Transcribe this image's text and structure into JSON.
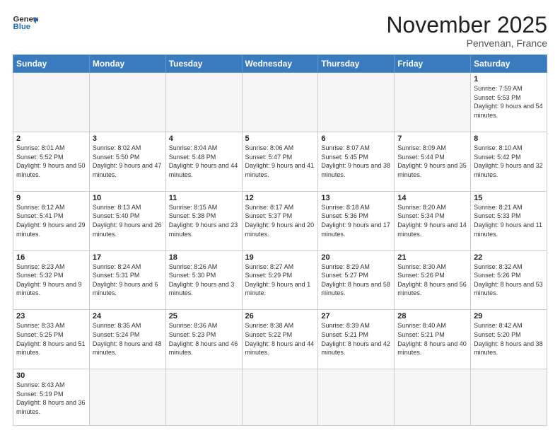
{
  "header": {
    "logo_general": "General",
    "logo_blue": "Blue",
    "month_title": "November 2025",
    "location": "Penvenan, France"
  },
  "days_of_week": [
    "Sunday",
    "Monday",
    "Tuesday",
    "Wednesday",
    "Thursday",
    "Friday",
    "Saturday"
  ],
  "weeks": [
    [
      {
        "day": "",
        "empty": true
      },
      {
        "day": "",
        "empty": true
      },
      {
        "day": "",
        "empty": true
      },
      {
        "day": "",
        "empty": true
      },
      {
        "day": "",
        "empty": true
      },
      {
        "day": "",
        "empty": true
      },
      {
        "day": "1",
        "sunrise": "7:59 AM",
        "sunset": "5:53 PM",
        "daylight": "9 hours and 54 minutes."
      }
    ],
    [
      {
        "day": "2",
        "sunrise": "8:01 AM",
        "sunset": "5:52 PM",
        "daylight": "9 hours and 50 minutes."
      },
      {
        "day": "3",
        "sunrise": "8:02 AM",
        "sunset": "5:50 PM",
        "daylight": "9 hours and 47 minutes."
      },
      {
        "day": "4",
        "sunrise": "8:04 AM",
        "sunset": "5:48 PM",
        "daylight": "9 hours and 44 minutes."
      },
      {
        "day": "5",
        "sunrise": "8:06 AM",
        "sunset": "5:47 PM",
        "daylight": "9 hours and 41 minutes."
      },
      {
        "day": "6",
        "sunrise": "8:07 AM",
        "sunset": "5:45 PM",
        "daylight": "9 hours and 38 minutes."
      },
      {
        "day": "7",
        "sunrise": "8:09 AM",
        "sunset": "5:44 PM",
        "daylight": "9 hours and 35 minutes."
      },
      {
        "day": "8",
        "sunrise": "8:10 AM",
        "sunset": "5:42 PM",
        "daylight": "9 hours and 32 minutes."
      }
    ],
    [
      {
        "day": "9",
        "sunrise": "8:12 AM",
        "sunset": "5:41 PM",
        "daylight": "9 hours and 29 minutes."
      },
      {
        "day": "10",
        "sunrise": "8:13 AM",
        "sunset": "5:40 PM",
        "daylight": "9 hours and 26 minutes."
      },
      {
        "day": "11",
        "sunrise": "8:15 AM",
        "sunset": "5:38 PM",
        "daylight": "9 hours and 23 minutes."
      },
      {
        "day": "12",
        "sunrise": "8:17 AM",
        "sunset": "5:37 PM",
        "daylight": "9 hours and 20 minutes."
      },
      {
        "day": "13",
        "sunrise": "8:18 AM",
        "sunset": "5:36 PM",
        "daylight": "9 hours and 17 minutes."
      },
      {
        "day": "14",
        "sunrise": "8:20 AM",
        "sunset": "5:34 PM",
        "daylight": "9 hours and 14 minutes."
      },
      {
        "day": "15",
        "sunrise": "8:21 AM",
        "sunset": "5:33 PM",
        "daylight": "9 hours and 11 minutes."
      }
    ],
    [
      {
        "day": "16",
        "sunrise": "8:23 AM",
        "sunset": "5:32 PM",
        "daylight": "9 hours and 9 minutes."
      },
      {
        "day": "17",
        "sunrise": "8:24 AM",
        "sunset": "5:31 PM",
        "daylight": "9 hours and 6 minutes."
      },
      {
        "day": "18",
        "sunrise": "8:26 AM",
        "sunset": "5:30 PM",
        "daylight": "9 hours and 3 minutes."
      },
      {
        "day": "19",
        "sunrise": "8:27 AM",
        "sunset": "5:29 PM",
        "daylight": "9 hours and 1 minute."
      },
      {
        "day": "20",
        "sunrise": "8:29 AM",
        "sunset": "5:27 PM",
        "daylight": "8 hours and 58 minutes."
      },
      {
        "day": "21",
        "sunrise": "8:30 AM",
        "sunset": "5:26 PM",
        "daylight": "8 hours and 56 minutes."
      },
      {
        "day": "22",
        "sunrise": "8:32 AM",
        "sunset": "5:26 PM",
        "daylight": "8 hours and 53 minutes."
      }
    ],
    [
      {
        "day": "23",
        "sunrise": "8:33 AM",
        "sunset": "5:25 PM",
        "daylight": "8 hours and 51 minutes."
      },
      {
        "day": "24",
        "sunrise": "8:35 AM",
        "sunset": "5:24 PM",
        "daylight": "8 hours and 48 minutes."
      },
      {
        "day": "25",
        "sunrise": "8:36 AM",
        "sunset": "5:23 PM",
        "daylight": "8 hours and 46 minutes."
      },
      {
        "day": "26",
        "sunrise": "8:38 AM",
        "sunset": "5:22 PM",
        "daylight": "8 hours and 44 minutes."
      },
      {
        "day": "27",
        "sunrise": "8:39 AM",
        "sunset": "5:21 PM",
        "daylight": "8 hours and 42 minutes."
      },
      {
        "day": "28",
        "sunrise": "8:40 AM",
        "sunset": "5:21 PM",
        "daylight": "8 hours and 40 minutes."
      },
      {
        "day": "29",
        "sunrise": "8:42 AM",
        "sunset": "5:20 PM",
        "daylight": "8 hours and 38 minutes."
      }
    ],
    [
      {
        "day": "30",
        "sunrise": "8:43 AM",
        "sunset": "5:19 PM",
        "daylight": "8 hours and 36 minutes."
      },
      {
        "day": "",
        "empty": true
      },
      {
        "day": "",
        "empty": true
      },
      {
        "day": "",
        "empty": true
      },
      {
        "day": "",
        "empty": true
      },
      {
        "day": "",
        "empty": true
      },
      {
        "day": "",
        "empty": true
      }
    ]
  ]
}
